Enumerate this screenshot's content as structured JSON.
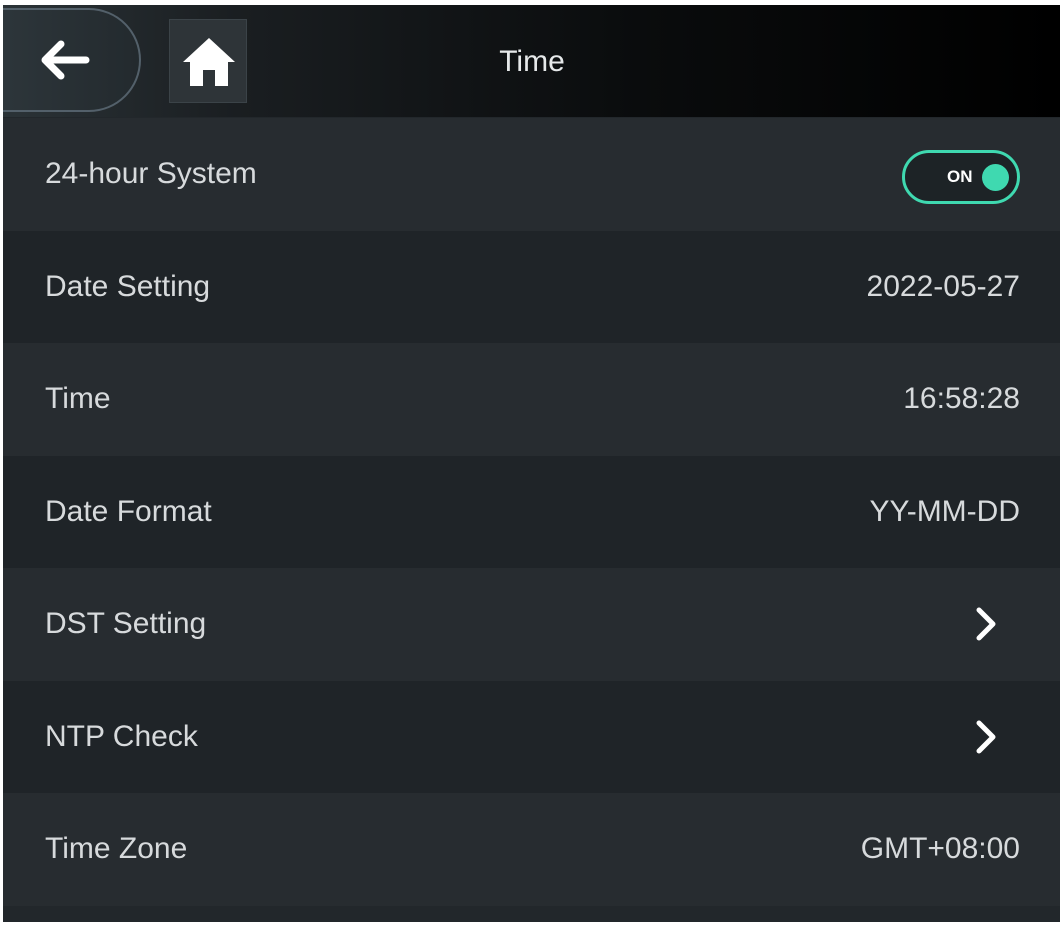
{
  "header": {
    "title": "Time",
    "back_icon": "arrow-left-icon",
    "home_icon": "home-icon"
  },
  "colors": {
    "accent": "#3fd9b0",
    "background": "#22272b",
    "text": "#d7dadc"
  },
  "settings": {
    "hour24": {
      "label": "24-hour System",
      "toggle_text": "ON",
      "enabled": true
    },
    "date_setting": {
      "label": "Date Setting",
      "value": "2022-05-27"
    },
    "time": {
      "label": "Time",
      "value": "16:58:28"
    },
    "date_format": {
      "label": "Date Format",
      "value": "YY-MM-DD"
    },
    "dst_setting": {
      "label": "DST Setting",
      "icon": "chevron-right-icon"
    },
    "ntp_check": {
      "label": "NTP Check",
      "icon": "chevron-right-icon"
    },
    "time_zone": {
      "label": "Time Zone",
      "value": "GMT+08:00"
    }
  }
}
